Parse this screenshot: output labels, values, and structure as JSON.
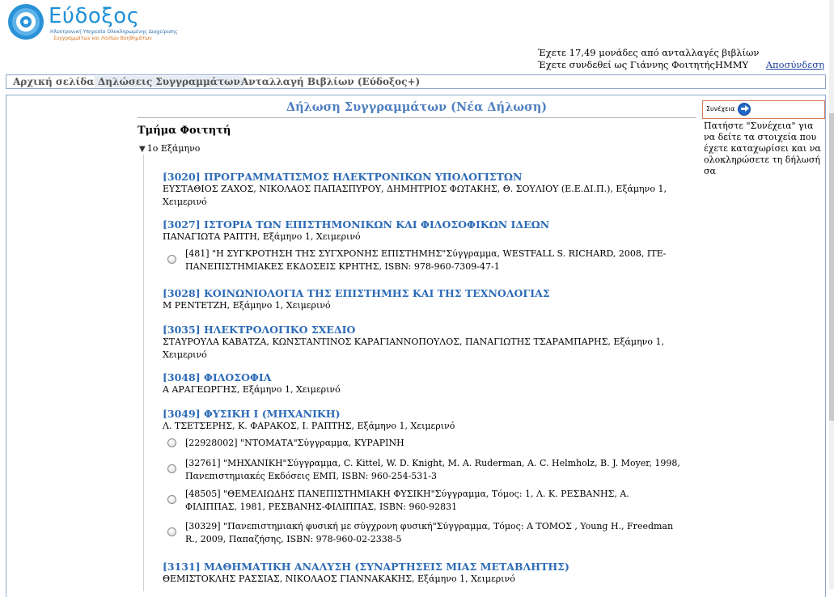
{
  "logo": {
    "title": "Εύδοξος",
    "sub1": "Ηλεκτρονική Υπηρεσία Ολοκληρωμένης Διαχείρισης",
    "sub2": "Συγγραμμάτων και Λοιπών Βοηθημάτων"
  },
  "user": {
    "credits": "Έχετε 17,49 μονάδες από ανταλλαγές βιβλίων",
    "logged_in": "Έχετε συνδεθεί ως Γιάννης ΦοιτητήςΗΜΜΥ",
    "logout": "Αποσύνδεση"
  },
  "nav": {
    "home": "Αρχική σελίδα",
    "declarations": "Δηλώσεις Συγγραμμάτων",
    "exchange": "Ανταλλαγή Βιβλίων (Εύδοξος+)"
  },
  "page": {
    "title": "Δήλωση Συγγραμμάτων (Νέα Δήλωση)",
    "dept": "Τμήμα Φοιτητή",
    "semester": "1ο Εξάμηνο"
  },
  "courses": [
    {
      "title": "[3020] ΠΡΟΓΡΑΜΜΑΤΙΣΜΟΣ ΗΛΕΚΤΡΟΝΙΚΩΝ ΥΠΟΛΟΓΙΣΤΩΝ",
      "info": "ΕΥΣΤΑΘΙΟΣ ΖΑΧΟΣ, ΝΙΚΟΛΑΟΣ ΠΑΠΑΣΠΥΡΟΥ, ΔΗΜΗΤΡΙΟΣ ΦΩΤΑΚΗΣ, Θ. ΣΟΥΛΙΟΥ (Ε.Ε.ΔΙ.Π.), Εξάμηνο 1, Χειμερινό"
    },
    {
      "title": "[3027] ΙΣΤΟΡΙΑ ΤΩΝ ΕΠΙΣΤΗΜΟΝΙΚΩΝ ΚΑΙ ΦΙΛΟΣΟΦΙΚΩΝ ΙΔΕΩΝ",
      "info": "ΠΑΝΑΓΙΩΤΑ ΡΑΠΤΗ, Εξάμηνο 1, Χειμερινό"
    },
    {
      "title": "[3028] ΚΟΙΝΩΝΙΟΛΟΓΙΑ ΤΗΣ ΕΠΙΣΤΗΜΗΣ ΚΑΙ ΤΗΣ ΤΕΧΝΟΛΟΓΙΑΣ",
      "info": "Μ ΡΕΝΤΕΤΖΗ, Εξάμηνο 1, Χειμερινό"
    },
    {
      "title": "[3035] ΗΛΕΚΤΡΟΛΟΓΙΚΟ ΣΧΕΔΙΟ",
      "info": "ΣΤΑΥΡΟΥΛΑ ΚΑΒΑΤΖΑ, ΚΩΝΣΤΑΝΤΙΝΟΣ ΚΑΡΑΓΙΑΝΝΟΠΟΥΛΟΣ, ΠΑΝΑΓΙΩΤΗΣ ΤΣΑΡΑΜΠΑΡΗΣ, Εξάμηνο 1, Χειμερινό"
    },
    {
      "title": "[3048] ΦΙΛΟΣΟΦΙΑ",
      "info": "Α ΑΡΑΓΕΩΡΓΗΣ, Εξάμηνο 1, Χειμερινό"
    },
    {
      "title": "[3049] ΦΥΣΙΚΗ Ι (ΜΗΧΑΝΙΚΗ)",
      "info": "Λ. ΤΣΕΤΣΕΡΗΣ, Κ. ΦΑΡΑΚΟΣ, Ι. ΡΑΠΤΗΣ, Εξάμηνο 1, Χειμερινό"
    },
    {
      "title": "[3131] ΜΑΘΗΜΑΤΙΚΗ ΑΝΑΛΥΣΗ (ΣΥΝΑΡΤΗΣΕΙΣ ΜΙΑΣ ΜΕΤΑΒΛΗΤΗΣ)",
      "info": "ΘΕΜΙΣΤΟΚΛΗΣ ΡΑΣΣΙΑΣ, ΝΙΚΟΛΑΟΣ ΓΙΑΝΝΑΚΑΚΗΣ, Εξάμηνο 1, Χειμερινό"
    }
  ],
  "books": [
    {
      "text": "[481] \"Η ΣΥΓΚΡΟΤΗΣΗ ΤΗΣ ΣΥΓΧΡΟΝΗΣ ΕΠΙΣΤΗΜΗΣ\"Σύγγραμμα, WESTFALL S. RICHARD, 2008, ΙΤΕ-ΠΑΝΕΠΙΣΤΗΜΙΑΚΕΣ ΕΚΔΟΣΕΙΣ ΚΡΗΤΗΣ, ISBN: 978-960-7309-47-1"
    },
    {
      "text": "[22928002] \"ΝΤΟΜΑΤΑ\"Σύγγραμμα, ΚΥΡΑΡΙΝΗ"
    },
    {
      "text": "[32761] \"ΜΗΧΑΝΙΚΗ\"Σύγγραμμα, C. Kittel, W. D. Knight, M. A. Ruderman, A. C. Helmholz, B. J. Moyer, 1998, Πανεπιστημιακές Εκδόσεις ΕΜΠ, ISBN: 960-254-531-3"
    },
    {
      "text": "[48505] \"ΘΕΜΕΛΙΩΔΗΣ ΠΑΝΕΠΙΣΤΗΜΙΑΚΗ ΦΥΣΙΚΗ\"Σύγγραμμα, Τόμος: 1, Λ. Κ. ΡΕΣΒΑΝΗΣ, Α. ΦΙΛΙΠΠΑΣ, 1981, ΡΕΣΒΑΝΗΣ-ΦΙΛΙΠΠΑΣ, ISBN: 960-92831"
    },
    {
      "text": "[30329] \"Πανεπιστημιακή φυσική με σύγχρονη φυσική\"Σύγγραμμα, Τόμος: Α ΤΟΜΟΣ , Young H., Freedman R., 2009, Παπαζήσης, ISBN: 978-960-02-2338-5"
    }
  ],
  "sidebar": {
    "continue": "Συνέχεια",
    "help": "Πατήστε \"Συνέχεια\" για να δείτε τα στοιχεία που έχετε καταχωρίσει και να ολοκληρώσετε τη δήλωσή σα"
  }
}
